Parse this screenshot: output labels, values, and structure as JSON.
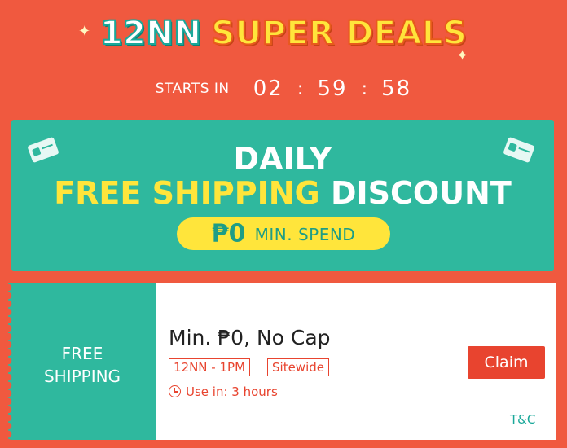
{
  "header": {
    "title_part1": "12NN",
    "title_part2": "SUPER DEALS"
  },
  "countdown": {
    "label": "STARTS IN",
    "hours": "02",
    "minutes": "59",
    "seconds": "58"
  },
  "banner": {
    "line1": "DAILY",
    "line2_highlight": "FREE SHIPPING",
    "line2_rest": "DISCOUNT",
    "pill_amount": "₱0",
    "pill_text": "MIN. SPEND"
  },
  "voucher": {
    "left_label_line1": "FREE",
    "left_label_line2": "SHIPPING",
    "title": "Min. ₱0, No Cap",
    "tags": [
      "12NN - 1PM",
      "Sitewide"
    ],
    "use_in": "Use in: 3 hours",
    "claim_label": "Claim",
    "tnc_label": "T&C"
  },
  "colors": {
    "background": "#f0593f",
    "teal": "#2fb89e",
    "yellow": "#ffe53b",
    "accent_red": "#e8442f"
  },
  "icons": {
    "voucher_ticket": "ticket-icon",
    "timer": "clock-icon"
  }
}
